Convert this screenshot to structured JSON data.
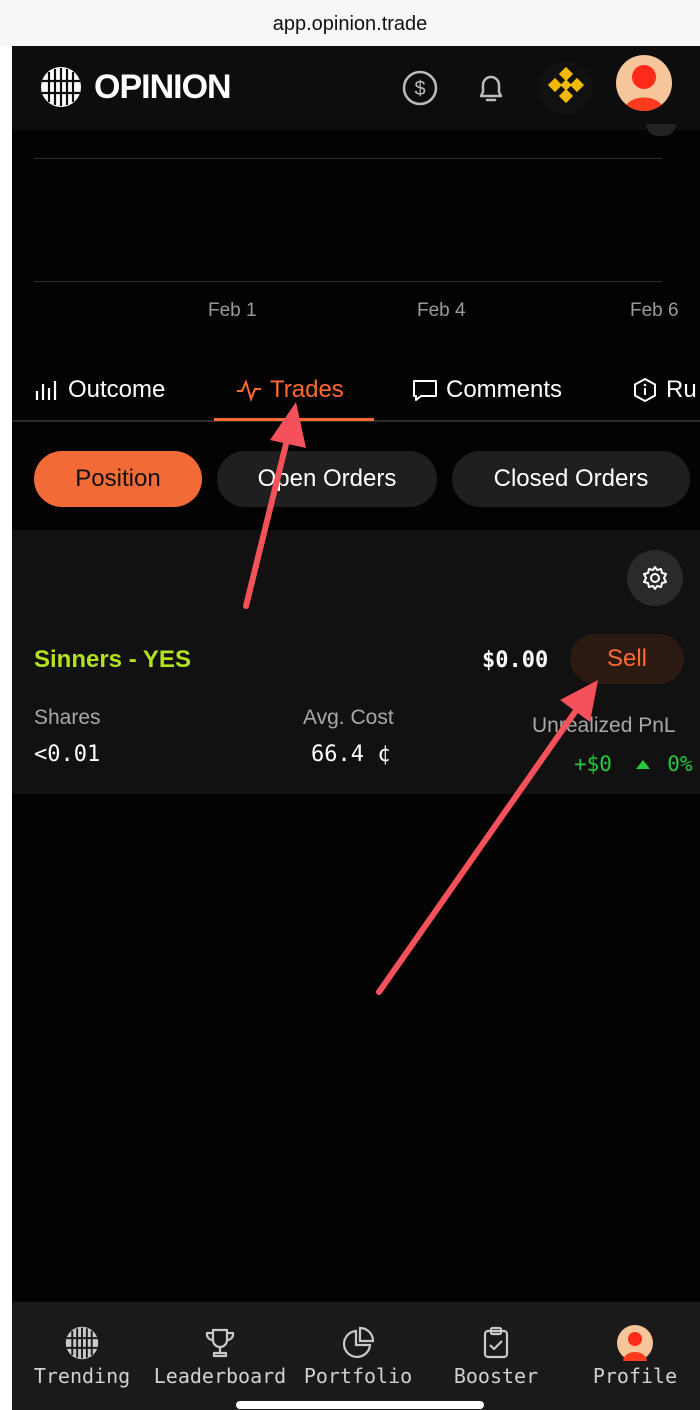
{
  "browser": {
    "url": "app.opinion.trade"
  },
  "header": {
    "logo_text": "OPINION",
    "icons": [
      "dollar-coin-icon",
      "bell-icon",
      "bnb-icon",
      "avatar"
    ]
  },
  "chart": {
    "x_ticks": [
      "Feb 1",
      "Feb 4",
      "Feb 6"
    ]
  },
  "tabs": [
    {
      "label": "Outcome",
      "icon": "bar-chart-icon"
    },
    {
      "label": "Trades",
      "icon": "activity-icon",
      "active": true
    },
    {
      "label": "Comments",
      "icon": "comment-icon"
    },
    {
      "label": "Ru",
      "icon": "info-icon"
    }
  ],
  "filters": [
    {
      "label": "Position",
      "active": true
    },
    {
      "label": "Open Orders"
    },
    {
      "label": "Closed Orders"
    }
  ],
  "position": {
    "market": "Sinners - YES",
    "value": "$0.00",
    "sell_label": "Sell",
    "shares_label": "Shares",
    "shares_value": "<0.01",
    "avg_cost_label": "Avg. Cost",
    "avg_cost_value": "66.4 ¢",
    "pnl_label": "Unrealized PnL",
    "pnl_value": "+$0",
    "pnl_pct": "0%"
  },
  "bottom_nav": [
    {
      "label": "Trending",
      "icon": "opinion-logo-icon"
    },
    {
      "label": "Leaderboard",
      "icon": "trophy-icon"
    },
    {
      "label": "Portfolio",
      "icon": "pie-chart-icon"
    },
    {
      "label": "Booster",
      "icon": "clipboard-check-icon"
    },
    {
      "label": "Profile",
      "icon": "avatar"
    }
  ],
  "colors": {
    "accent": "#ff6a33",
    "market_green": "#b5e01e",
    "pnl_green": "#27c93f",
    "annotation_arrow": "#f4515a"
  }
}
